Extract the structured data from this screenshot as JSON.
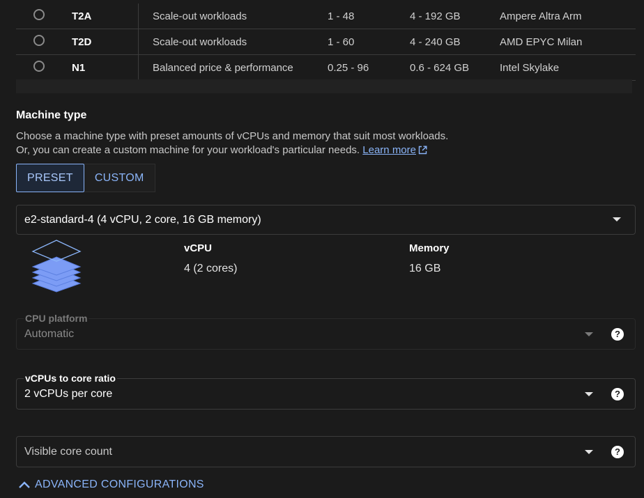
{
  "series_table": {
    "rows": [
      {
        "name": "T2A",
        "description": "Scale-out workloads",
        "vcpus": "1 - 48",
        "memory": "4 - 192 GB",
        "platform": "Ampere Altra Arm"
      },
      {
        "name": "T2D",
        "description": "Scale-out workloads",
        "vcpus": "1 - 60",
        "memory": "4 - 240 GB",
        "platform": "AMD EPYC Milan"
      },
      {
        "name": "N1",
        "description": "Balanced price & performance",
        "vcpus": "0.25 - 96",
        "memory": "0.6 - 624 GB",
        "platform": "Intel Skylake"
      }
    ]
  },
  "machine_type": {
    "title": "Machine type",
    "description_line1": "Choose a machine type with preset amounts of vCPUs and memory that suit most workloads.",
    "description_line2": "Or, you can create a custom machine for your workload's particular needs.",
    "learn_more": "Learn more",
    "preset_label": "PRESET",
    "custom_label": "CUSTOM",
    "selected": "e2-standard-4 (4 vCPU, 2 core, 16 GB memory)",
    "vcpu_label": "vCPU",
    "vcpu_value": "4 (2 cores)",
    "memory_label": "Memory",
    "memory_value": "16 GB"
  },
  "cpu_platform": {
    "label": "CPU platform",
    "value": "Automatic"
  },
  "vcpu_core_ratio": {
    "label": "vCPUs to core ratio",
    "value": "2 vCPUs per core"
  },
  "visible_core_count": {
    "placeholder": "Visible core count"
  },
  "advanced": {
    "label": "ADVANCED CONFIGURATIONS"
  },
  "colors": {
    "accent": "#8ab4f8",
    "background": "#1b1b1b",
    "stack_fill": "#7c9cf5"
  }
}
